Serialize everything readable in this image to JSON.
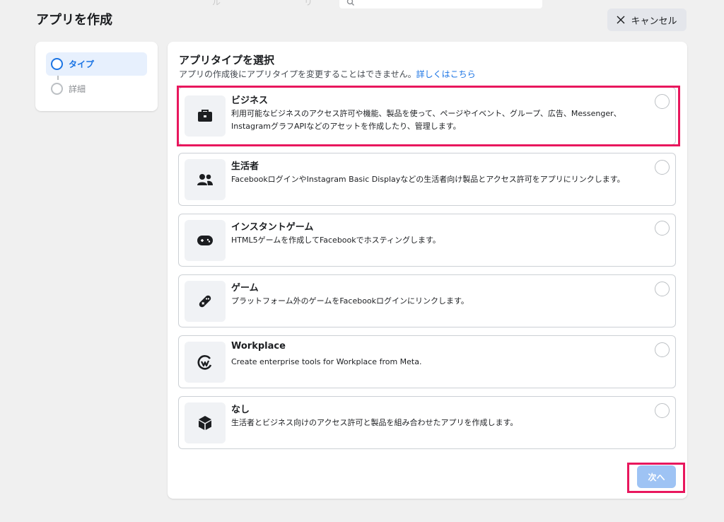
{
  "header": {
    "page_title": "アプリを作成",
    "cancel_label": "キャンセル",
    "ghost_nav": [
      "ル",
      "リ"
    ]
  },
  "steps": [
    {
      "label": "タイプ",
      "state": "active"
    },
    {
      "label": "詳細",
      "state": "inactive"
    }
  ],
  "main": {
    "title": "アプリタイプを選択",
    "subtitle": "アプリの作成後にアプリタイプを変更することはできません。",
    "learn_more": "詳しくはこちら",
    "options": [
      {
        "title": "ビジネス",
        "description": "利用可能なビジネスのアクセス許可や機能、製品を使って、ページやイベント、グループ、広告、Messenger、InstagramグラフAPIなどのアセットを作成したり、管理します。",
        "icon": "briefcase-icon"
      },
      {
        "title": "生活者",
        "description": "FacebookログインやInstagram Basic Displayなどの生活者向け製品とアクセス許可をアプリにリンクします。",
        "icon": "people-icon"
      },
      {
        "title": "インスタントゲーム",
        "description": "HTML5ゲームを作成してFacebookでホスティングします。",
        "icon": "gamepad-icon"
      },
      {
        "title": "ゲーム",
        "description": "プラットフォーム外のゲームをFacebookログインにリンクします。",
        "icon": "game-controller-icon"
      },
      {
        "title": "Workplace",
        "description": "Create enterprise tools for Workplace from Meta.",
        "icon": "workplace-icon"
      },
      {
        "title": "なし",
        "description": "生活者とビジネス向けのアクセス許可と製品を組み合わせたアプリを作成します。",
        "icon": "cube-icon"
      }
    ],
    "next_label": "次へ"
  },
  "colors": {
    "accent": "#1b74e4",
    "highlight": "#e8175d",
    "next_disabled": "#9ec3f4"
  }
}
